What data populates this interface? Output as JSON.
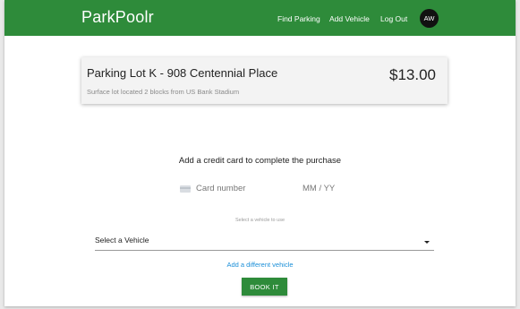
{
  "navbar": {
    "brand": "ParkPoolr",
    "links": [
      "Find Parking",
      "Add Vehicle",
      "Log Out"
    ],
    "avatar_initials": "AW",
    "background_color": "#2e8b3a"
  },
  "lot": {
    "title": "Parking Lot K - 908 Centennial Place",
    "description": "Surface lot located 2 blocks from US Bank Stadium",
    "price": "$13.00"
  },
  "payment": {
    "prompt": "Add a credit card to complete the purchase",
    "card_number_placeholder": "Card number",
    "expiry_placeholder": "MM / YY",
    "card_icon": "credit-card-icon"
  },
  "vehicle": {
    "hint": "Select a vehicle to use",
    "select_label": "Select a Vehicle",
    "add_link": "Add a different vehicle",
    "dropdown_icon": "chevron-down-icon"
  },
  "actions": {
    "book_label": "BOOK IT",
    "accent_color": "#1b8fd8"
  }
}
